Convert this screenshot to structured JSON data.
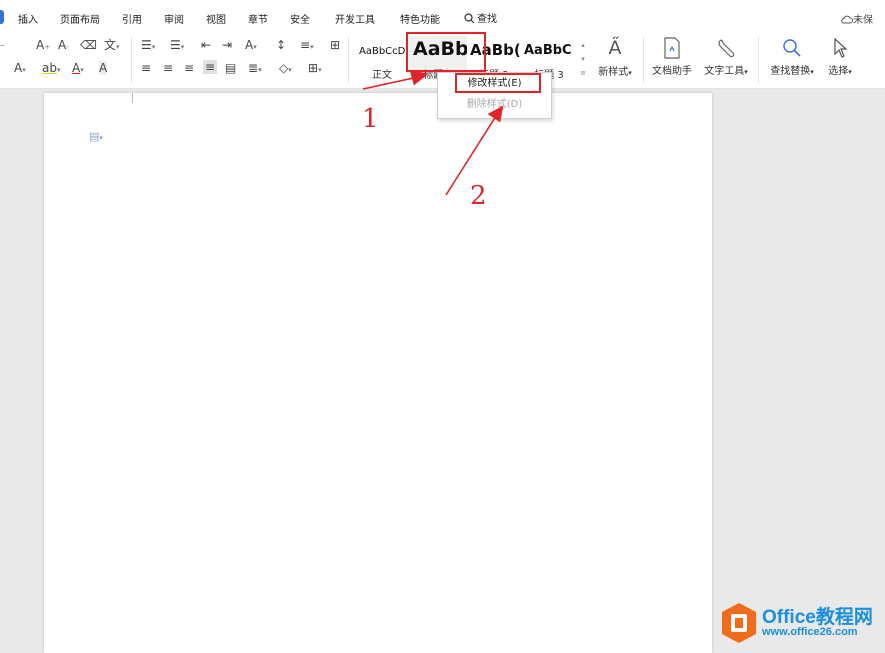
{
  "menubar": {
    "items": [
      "插入",
      "页面布局",
      "引用",
      "审阅",
      "视图",
      "章节",
      "安全",
      "开发工具",
      "特色功能"
    ],
    "search_label": "查找",
    "unsaved_label": "未保"
  },
  "toolbar": {
    "styles": [
      {
        "sample": "AaBbCcDd",
        "name": "正文"
      },
      {
        "sample": "AaBb",
        "name": "标题 1"
      },
      {
        "sample": "AaBb(",
        "name": "标题 2"
      },
      {
        "sample": "AaBbC",
        "name": "标题 3"
      }
    ],
    "new_style_label": "新样式",
    "doc_assistant_label": "文档助手",
    "text_tools_label": "文字工具",
    "find_replace_label": "查找替换",
    "select_label": "选择"
  },
  "context_menu": {
    "modify_style": "修改样式(E)",
    "delete_style": "删除样式(D)"
  },
  "annotations": {
    "step1": "1",
    "step2": "2",
    "color": "#e0242a"
  },
  "watermark": {
    "brand": "Office教程网",
    "url": "www.office26.com"
  },
  "colors": {
    "accent": "#3b6fd8",
    "annotation_red": "#e0242a",
    "logo_orange": "#f26b1d",
    "logo_blue": "#1a8fe0"
  }
}
